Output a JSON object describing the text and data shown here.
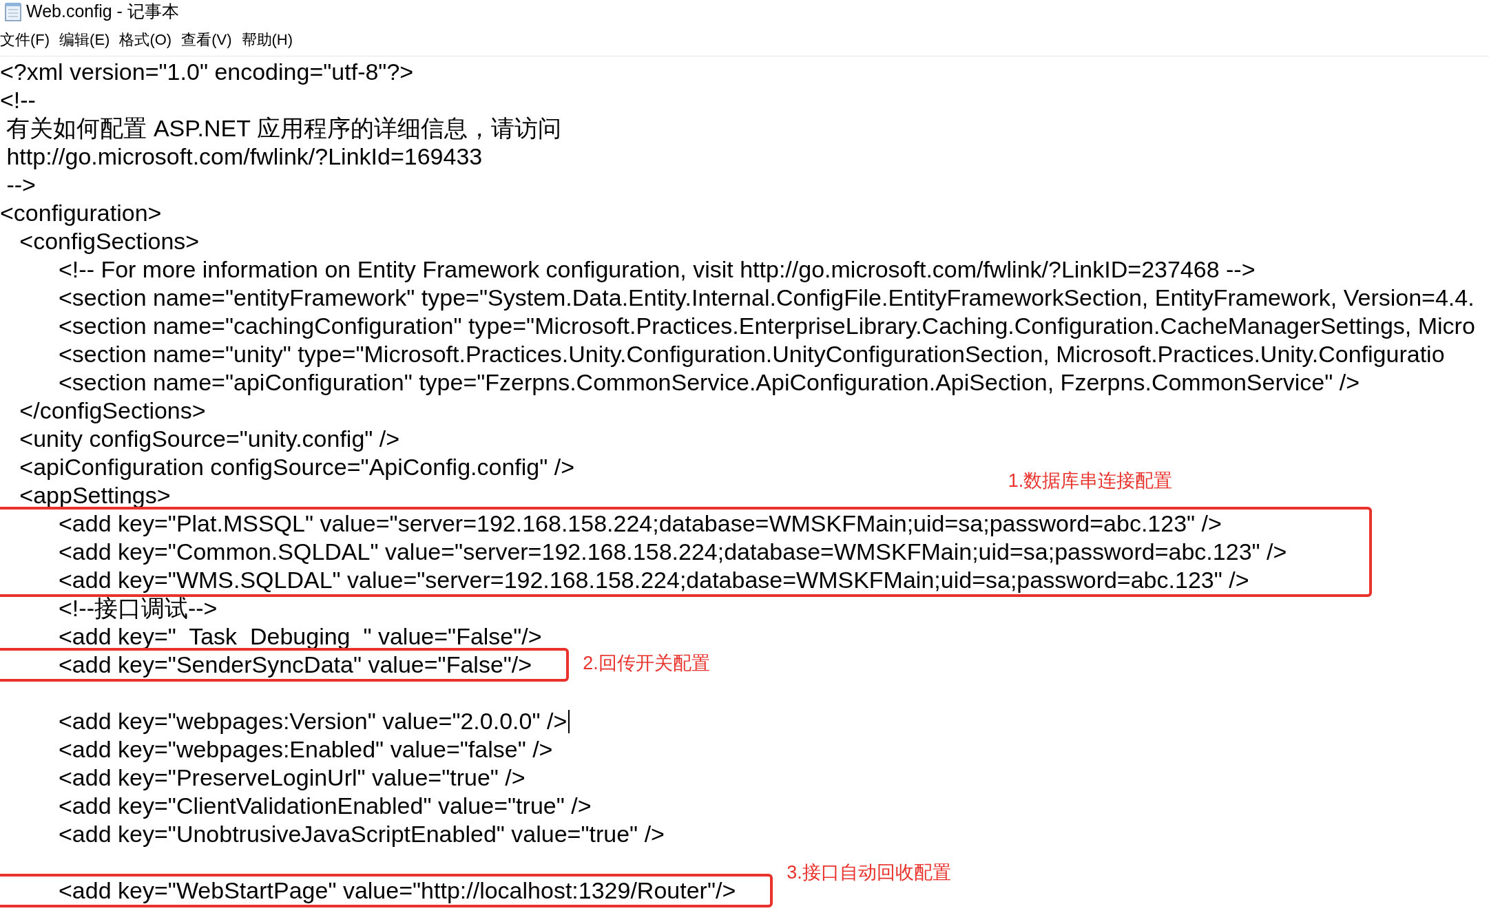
{
  "window": {
    "title": "Web.config - 记事本"
  },
  "menu": [
    "文件(F)",
    "编辑(E)",
    "格式(O)",
    "查看(V)",
    "帮助(H)"
  ],
  "editor": {
    "lines": [
      {
        "kind": "line",
        "text": "<?xml version=\"1.0\" encoding=\"utf-8\"?>"
      },
      {
        "kind": "line",
        "text": "<!--"
      },
      {
        "kind": "line",
        "text": " 有关如何配置 ASP.NET 应用程序的详细信息，请访问"
      },
      {
        "kind": "line",
        "text": " http://go.microsoft.com/fwlink/?LinkId=169433"
      },
      {
        "kind": "line",
        "text": " -->"
      },
      {
        "kind": "line",
        "text": "<configuration>"
      },
      {
        "kind": "line",
        "text": "   <configSections>"
      },
      {
        "kind": "line",
        "text": "         <!-- For more information on Entity Framework configuration, visit http://go.microsoft.com/fwlink/?LinkID=237468 -->"
      },
      {
        "kind": "line",
        "text": "         <section name=\"entityFramework\" type=\"System.Data.Entity.Internal.ConfigFile.EntityFrameworkSection, EntityFramework, Version=4.4."
      },
      {
        "kind": "line",
        "text": "         <section name=\"cachingConfiguration\" type=\"Microsoft.Practices.EnterpriseLibrary.Caching.Configuration.CacheManagerSettings, Micro"
      },
      {
        "kind": "line",
        "text": "         <section name=\"unity\" type=\"Microsoft.Practices.Unity.Configuration.UnityConfigurationSection, Microsoft.Practices.Unity.Configuratio"
      },
      {
        "kind": "line",
        "text": "         <section name=\"apiConfiguration\" type=\"Fzerpns.CommonService.ApiConfiguration.ApiSection, Fzerpns.CommonService\" />"
      },
      {
        "kind": "line",
        "text": "   </configSections>"
      },
      {
        "kind": "line",
        "text": "   <unity configSource=\"unity.config\" />"
      },
      {
        "kind": "line",
        "text": "   <apiConfiguration configSource=\"ApiConfig.config\" />"
      },
      {
        "kind": "line",
        "text": "   <appSettings>"
      },
      {
        "kind": "callout",
        "label": "1.数据库串连接配置",
        "lines": [
          "         <add key=\"Plat.MSSQL\" value=\"server=192.168.158.224;database=WMSKFMain;uid=sa;password=abc.123\" />",
          "         <add key=\"Common.SQLDAL\" value=\"server=192.168.158.224;database=WMSKFMain;uid=sa;password=abc.123\" />",
          "         <add key=\"WMS.SQLDAL\" value=\"server=192.168.158.224;database=WMSKFMain;uid=sa;password=abc.123\" />"
        ]
      },
      {
        "kind": "line",
        "text": "         <!--接口调试-->"
      },
      {
        "kind": "line",
        "text": "         <add key=\"  Task  Debuging  \" value=\"False\"/>"
      },
      {
        "kind": "callout",
        "label": "2.回传开关配置",
        "lines": [
          "         <add key=\"SenderSyncData\" value=\"False\"/>"
        ]
      },
      {
        "kind": "blank"
      },
      {
        "kind": "line",
        "text": "         <add key=\"webpages:Version\" value=\"2.0.0.0\" />",
        "cursor": true
      },
      {
        "kind": "line",
        "text": "         <add key=\"webpages:Enabled\" value=\"false\" />"
      },
      {
        "kind": "line",
        "text": "         <add key=\"PreserveLoginUrl\" value=\"true\" />"
      },
      {
        "kind": "line",
        "text": "         <add key=\"ClientValidationEnabled\" value=\"true\" />"
      },
      {
        "kind": "line",
        "text": "         <add key=\"UnobtrusiveJavaScriptEnabled\" value=\"true\" />"
      },
      {
        "kind": "blank"
      },
      {
        "kind": "callout",
        "label": "3.接口自动回收配置",
        "lines": [
          "         <add key=\"WebStartPage\" value=\"http://localhost:1329/Router\"/>"
        ]
      }
    ]
  }
}
